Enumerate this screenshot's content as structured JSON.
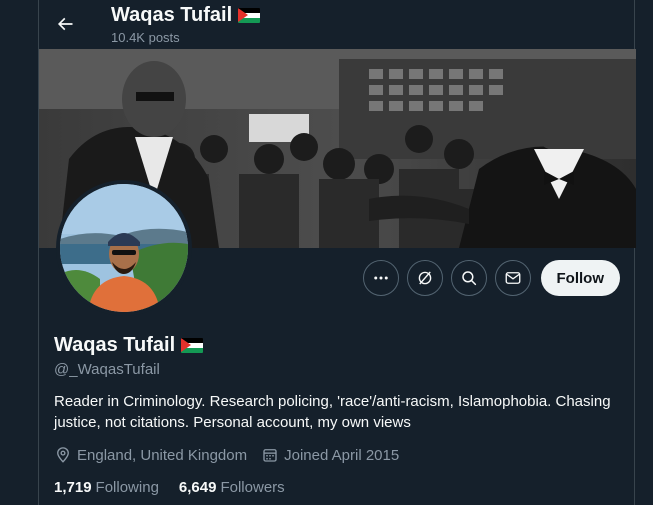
{
  "header": {
    "title": "Waqas Tufail",
    "posts_count": "10.4K posts"
  },
  "profile": {
    "name": "Waqas Tufail",
    "handle": "@_WaqasTufail",
    "bio": "Reader in Criminology. Research policing, 'race'/anti-racism, Islamophobia. Chasing justice, not citations. Personal account, my own views",
    "location": "England, United Kingdom",
    "joined": "Joined April 2015",
    "following_count": "1,719",
    "following_label": "Following",
    "followers_count": "6,649",
    "followers_label": "Followers"
  },
  "actions": {
    "more_icon": "more-icon",
    "grok_icon": "grok-icon",
    "search_icon": "search-icon",
    "message_icon": "mail-icon",
    "follow_label": "Follow"
  },
  "colors": {
    "background": "#15202b",
    "text_primary": "#f7f9f9",
    "text_secondary": "#8b98a5",
    "border": "#536471",
    "follow_bg": "#eff3f4",
    "flag_red": "#e4312b",
    "flag_green": "#149954"
  }
}
